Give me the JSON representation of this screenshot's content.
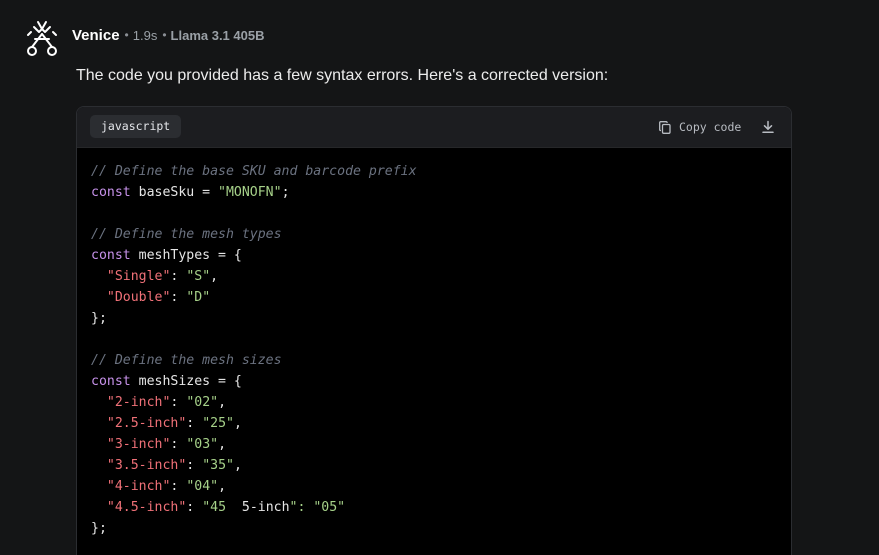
{
  "message": {
    "bot_name": "Venice",
    "separator": "•",
    "response_time": "1.9s",
    "model": "Llama 3.1 405B",
    "avatar_icon": "venice-crossed-keys-icon",
    "intro_text": "The code you provided has a few syntax errors. Here's a corrected version:"
  },
  "code_block": {
    "language": "javascript",
    "copy_label": "Copy code",
    "copy_icon": "copy-icon",
    "download_icon": "download-icon",
    "colors": {
      "comment": "#6b7280",
      "keyword": "#c792ea",
      "string": "#a6d189",
      "key": "#f07178",
      "text": "#e6e6e6"
    },
    "lines": [
      [
        {
          "t": "comment",
          "v": "// Define the base SKU and barcode prefix"
        }
      ],
      [
        {
          "t": "keyword",
          "v": "const"
        },
        {
          "t": "ident",
          "v": " baseSku = "
        },
        {
          "t": "string",
          "v": "\"MONOFN\""
        },
        {
          "t": "punct",
          "v": ";"
        }
      ],
      [],
      [
        {
          "t": "comment",
          "v": "// Define the mesh types"
        }
      ],
      [
        {
          "t": "keyword",
          "v": "const"
        },
        {
          "t": "ident",
          "v": " meshTypes = {"
        }
      ],
      [
        {
          "t": "punct",
          "v": "  "
        },
        {
          "t": "key",
          "v": "\"Single\""
        },
        {
          "t": "punct",
          "v": ": "
        },
        {
          "t": "string",
          "v": "\"S\""
        },
        {
          "t": "punct",
          "v": ","
        }
      ],
      [
        {
          "t": "punct",
          "v": "  "
        },
        {
          "t": "key",
          "v": "\"Double\""
        },
        {
          "t": "punct",
          "v": ": "
        },
        {
          "t": "string",
          "v": "\"D\""
        }
      ],
      [
        {
          "t": "punct",
          "v": "};"
        }
      ],
      [],
      [
        {
          "t": "comment",
          "v": "// Define the mesh sizes"
        }
      ],
      [
        {
          "t": "keyword",
          "v": "const"
        },
        {
          "t": "ident",
          "v": " meshSizes = {"
        }
      ],
      [
        {
          "t": "punct",
          "v": "  "
        },
        {
          "t": "key",
          "v": "\"2-inch\""
        },
        {
          "t": "punct",
          "v": ": "
        },
        {
          "t": "string",
          "v": "\"02\""
        },
        {
          "t": "punct",
          "v": ","
        }
      ],
      [
        {
          "t": "punct",
          "v": "  "
        },
        {
          "t": "key",
          "v": "\"2.5-inch\""
        },
        {
          "t": "punct",
          "v": ": "
        },
        {
          "t": "string",
          "v": "\"25\""
        },
        {
          "t": "punct",
          "v": ","
        }
      ],
      [
        {
          "t": "punct",
          "v": "  "
        },
        {
          "t": "key",
          "v": "\"3-inch\""
        },
        {
          "t": "punct",
          "v": ": "
        },
        {
          "t": "string",
          "v": "\"03\""
        },
        {
          "t": "punct",
          "v": ","
        }
      ],
      [
        {
          "t": "punct",
          "v": "  "
        },
        {
          "t": "key",
          "v": "\"3.5-inch\""
        },
        {
          "t": "punct",
          "v": ": "
        },
        {
          "t": "string",
          "v": "\"35\""
        },
        {
          "t": "punct",
          "v": ","
        }
      ],
      [
        {
          "t": "punct",
          "v": "  "
        },
        {
          "t": "key",
          "v": "\"4-inch\""
        },
        {
          "t": "punct",
          "v": ": "
        },
        {
          "t": "string",
          "v": "\"04\""
        },
        {
          "t": "punct",
          "v": ","
        }
      ],
      [
        {
          "t": "punct",
          "v": "  "
        },
        {
          "t": "key",
          "v": "\"4.5-inch\""
        },
        {
          "t": "punct",
          "v": ": "
        },
        {
          "t": "string",
          "v": "\"45  "
        },
        {
          "t": "ident",
          "v": "5-inch"
        },
        {
          "t": "string",
          "v": "\": \"05\""
        }
      ],
      [
        {
          "t": "punct",
          "v": "};"
        }
      ]
    ]
  }
}
